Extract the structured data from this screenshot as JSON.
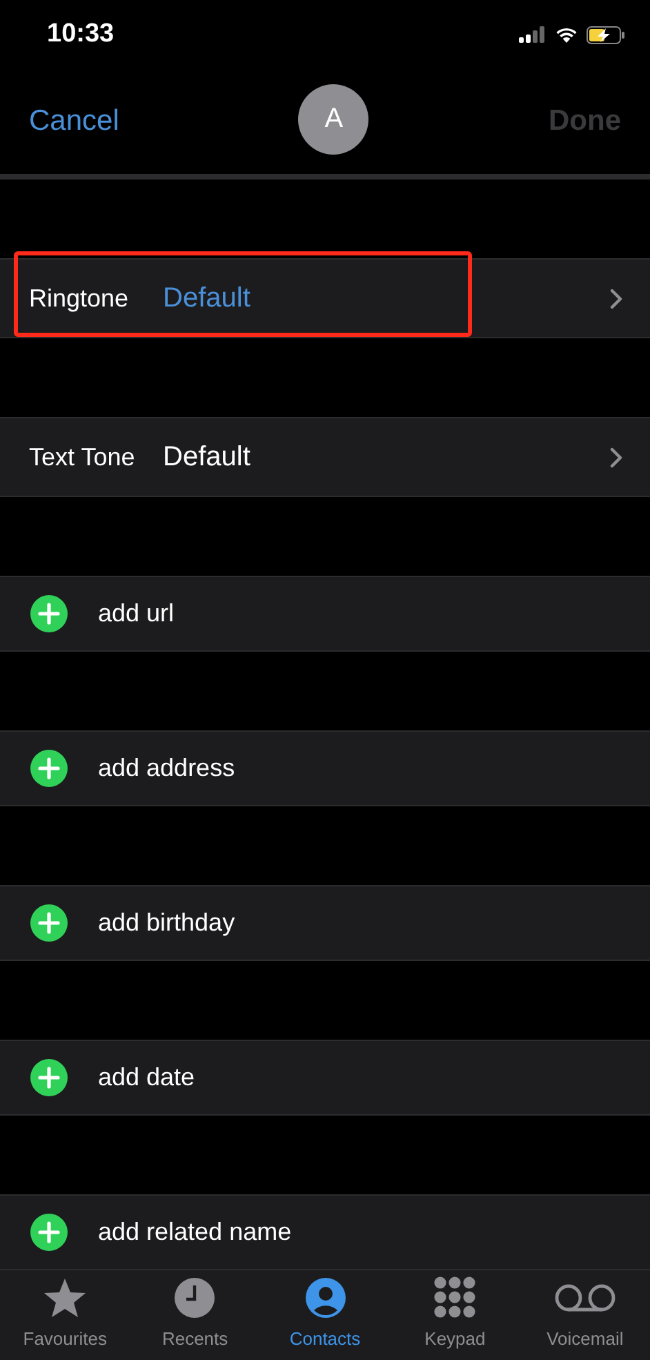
{
  "status_bar": {
    "time": "10:33"
  },
  "nav": {
    "cancel": "Cancel",
    "avatar": "A",
    "done": "Done",
    "done_disabled": true
  },
  "tone_rows": [
    {
      "label": "Ringtone",
      "value": "Default",
      "selected": true,
      "highlighted": true
    },
    {
      "label": "Text Tone",
      "value": "Default",
      "selected": false,
      "highlighted": false
    }
  ],
  "add_rows": [
    {
      "label": "add url"
    },
    {
      "label": "add address"
    },
    {
      "label": "add birthday"
    },
    {
      "label": "add date"
    },
    {
      "label": "add related name"
    }
  ],
  "tabs": [
    {
      "kind": "star",
      "label": "Favourites",
      "selected": false
    },
    {
      "kind": "clock",
      "label": "Recents",
      "selected": false
    },
    {
      "kind": "person",
      "label": "Contacts",
      "selected": true
    },
    {
      "kind": "keypad",
      "label": "Keypad",
      "selected": false
    },
    {
      "kind": "voicemail",
      "label": "Voicemail",
      "selected": false
    }
  ]
}
